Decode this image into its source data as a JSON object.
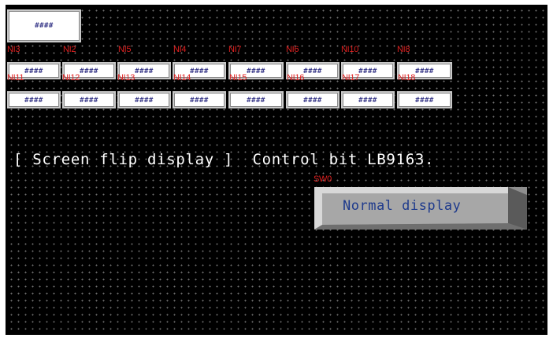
{
  "top_box": {
    "value": "####"
  },
  "tag_row": [
    "NI3",
    "NI2",
    "NI5",
    "NI4",
    "NI7",
    "NI6",
    "NI10",
    "NI8"
  ],
  "row1": {
    "tags": [
      "NI11",
      "NI12",
      "NI13",
      "NI14",
      "NI15",
      "NI16",
      "NI17",
      "NI18"
    ],
    "values": [
      "####",
      "####",
      "####",
      "####",
      "####",
      "####",
      "####",
      "####"
    ]
  },
  "row2": {
    "values": [
      "####",
      "####",
      "####",
      "####",
      "####",
      "####",
      "####",
      "####"
    ]
  },
  "caption": "[ Screen flip display ]  Control bit LB9163.",
  "switch": {
    "tag": "SW0",
    "label": "Normal display"
  },
  "colors": {
    "background": "#000000",
    "grid_dot": "#6e6e6e",
    "tag_text": "#e02020",
    "value_text": "#3a3a8a",
    "switch_text": "#1e3a8c",
    "caption_text": "#ffffff"
  }
}
